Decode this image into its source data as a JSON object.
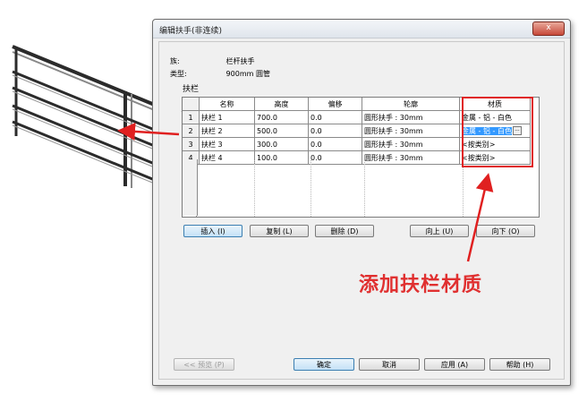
{
  "dialog": {
    "title": "编辑扶手(非连续)",
    "close_label": "x",
    "family_label": "族:",
    "family_value": "栏杆扶手",
    "type_label": "类型:",
    "type_value": "900mm 圆管",
    "group_label": "扶栏"
  },
  "table": {
    "headers": [
      "名称",
      "高度",
      "偏移",
      "轮廓",
      "材质"
    ],
    "rows": [
      {
        "idx": "1",
        "name": "扶栏 1",
        "height": "700.0",
        "offset": "0.0",
        "profile": "圆形扶手 : 30mm",
        "material": "金属 - 铝 - 白色"
      },
      {
        "idx": "2",
        "name": "扶栏 2",
        "height": "500.0",
        "offset": "0.0",
        "profile": "圆形扶手 : 30mm",
        "material": "金属 - 铝 - 白色"
      },
      {
        "idx": "3",
        "name": "扶栏 3",
        "height": "300.0",
        "offset": "0.0",
        "profile": "圆形扶手 : 30mm",
        "material": "<按类别>"
      },
      {
        "idx": "4",
        "name": "扶栏 4",
        "height": "100.0",
        "offset": "0.0",
        "profile": "圆形扶手 : 30mm",
        "material": "<按类别>"
      }
    ],
    "ellipsis": "..."
  },
  "row_buttons": {
    "insert": "插入 (I)",
    "copy": "复制 (L)",
    "delete": "删除 (D)",
    "up": "向上 (U)",
    "down": "向下 (O)"
  },
  "footer_buttons": {
    "preview": "<< 预览 (P)",
    "ok": "确定",
    "cancel": "取消",
    "apply": "应用 (A)",
    "help": "帮助 (H)"
  },
  "annotation": {
    "text": "添加扶栏材质",
    "color": "#e02020"
  }
}
